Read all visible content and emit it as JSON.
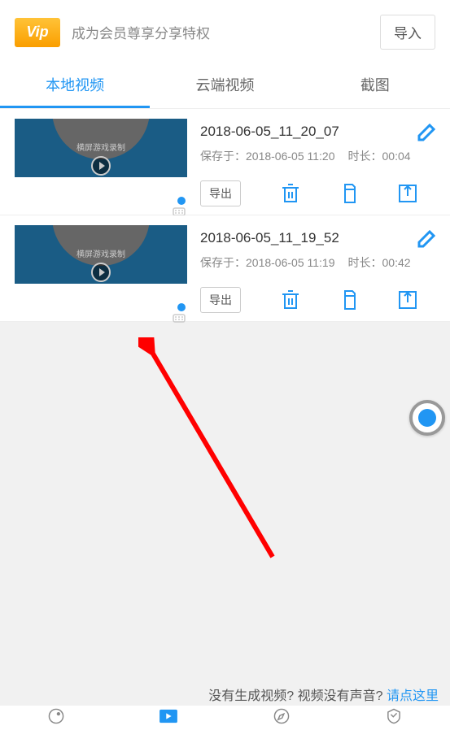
{
  "header": {
    "vip_label": "Vip",
    "promo_text": "成为会员尊享分享特权",
    "import_btn": "导入"
  },
  "tabs": {
    "local": "本地视频",
    "cloud": "云端视频",
    "screenshot": "截图"
  },
  "videos": [
    {
      "title": "2018-06-05_11_20_07",
      "saved_at": "保存于：2018-06-05 11:20",
      "duration": "时长：00:04",
      "export": "导出",
      "thumb_label": "横屏游戏录制"
    },
    {
      "title": "2018-06-05_11_19_52",
      "saved_at": "保存于：2018-06-05 11:19",
      "duration": "时长：00:42",
      "export": "导出",
      "thumb_label": "横屏游戏录制"
    }
  ],
  "footer": {
    "hint_q1": "没有生成视频?",
    "hint_q2": "视频没有声音?",
    "hint_link": "请点这里"
  }
}
